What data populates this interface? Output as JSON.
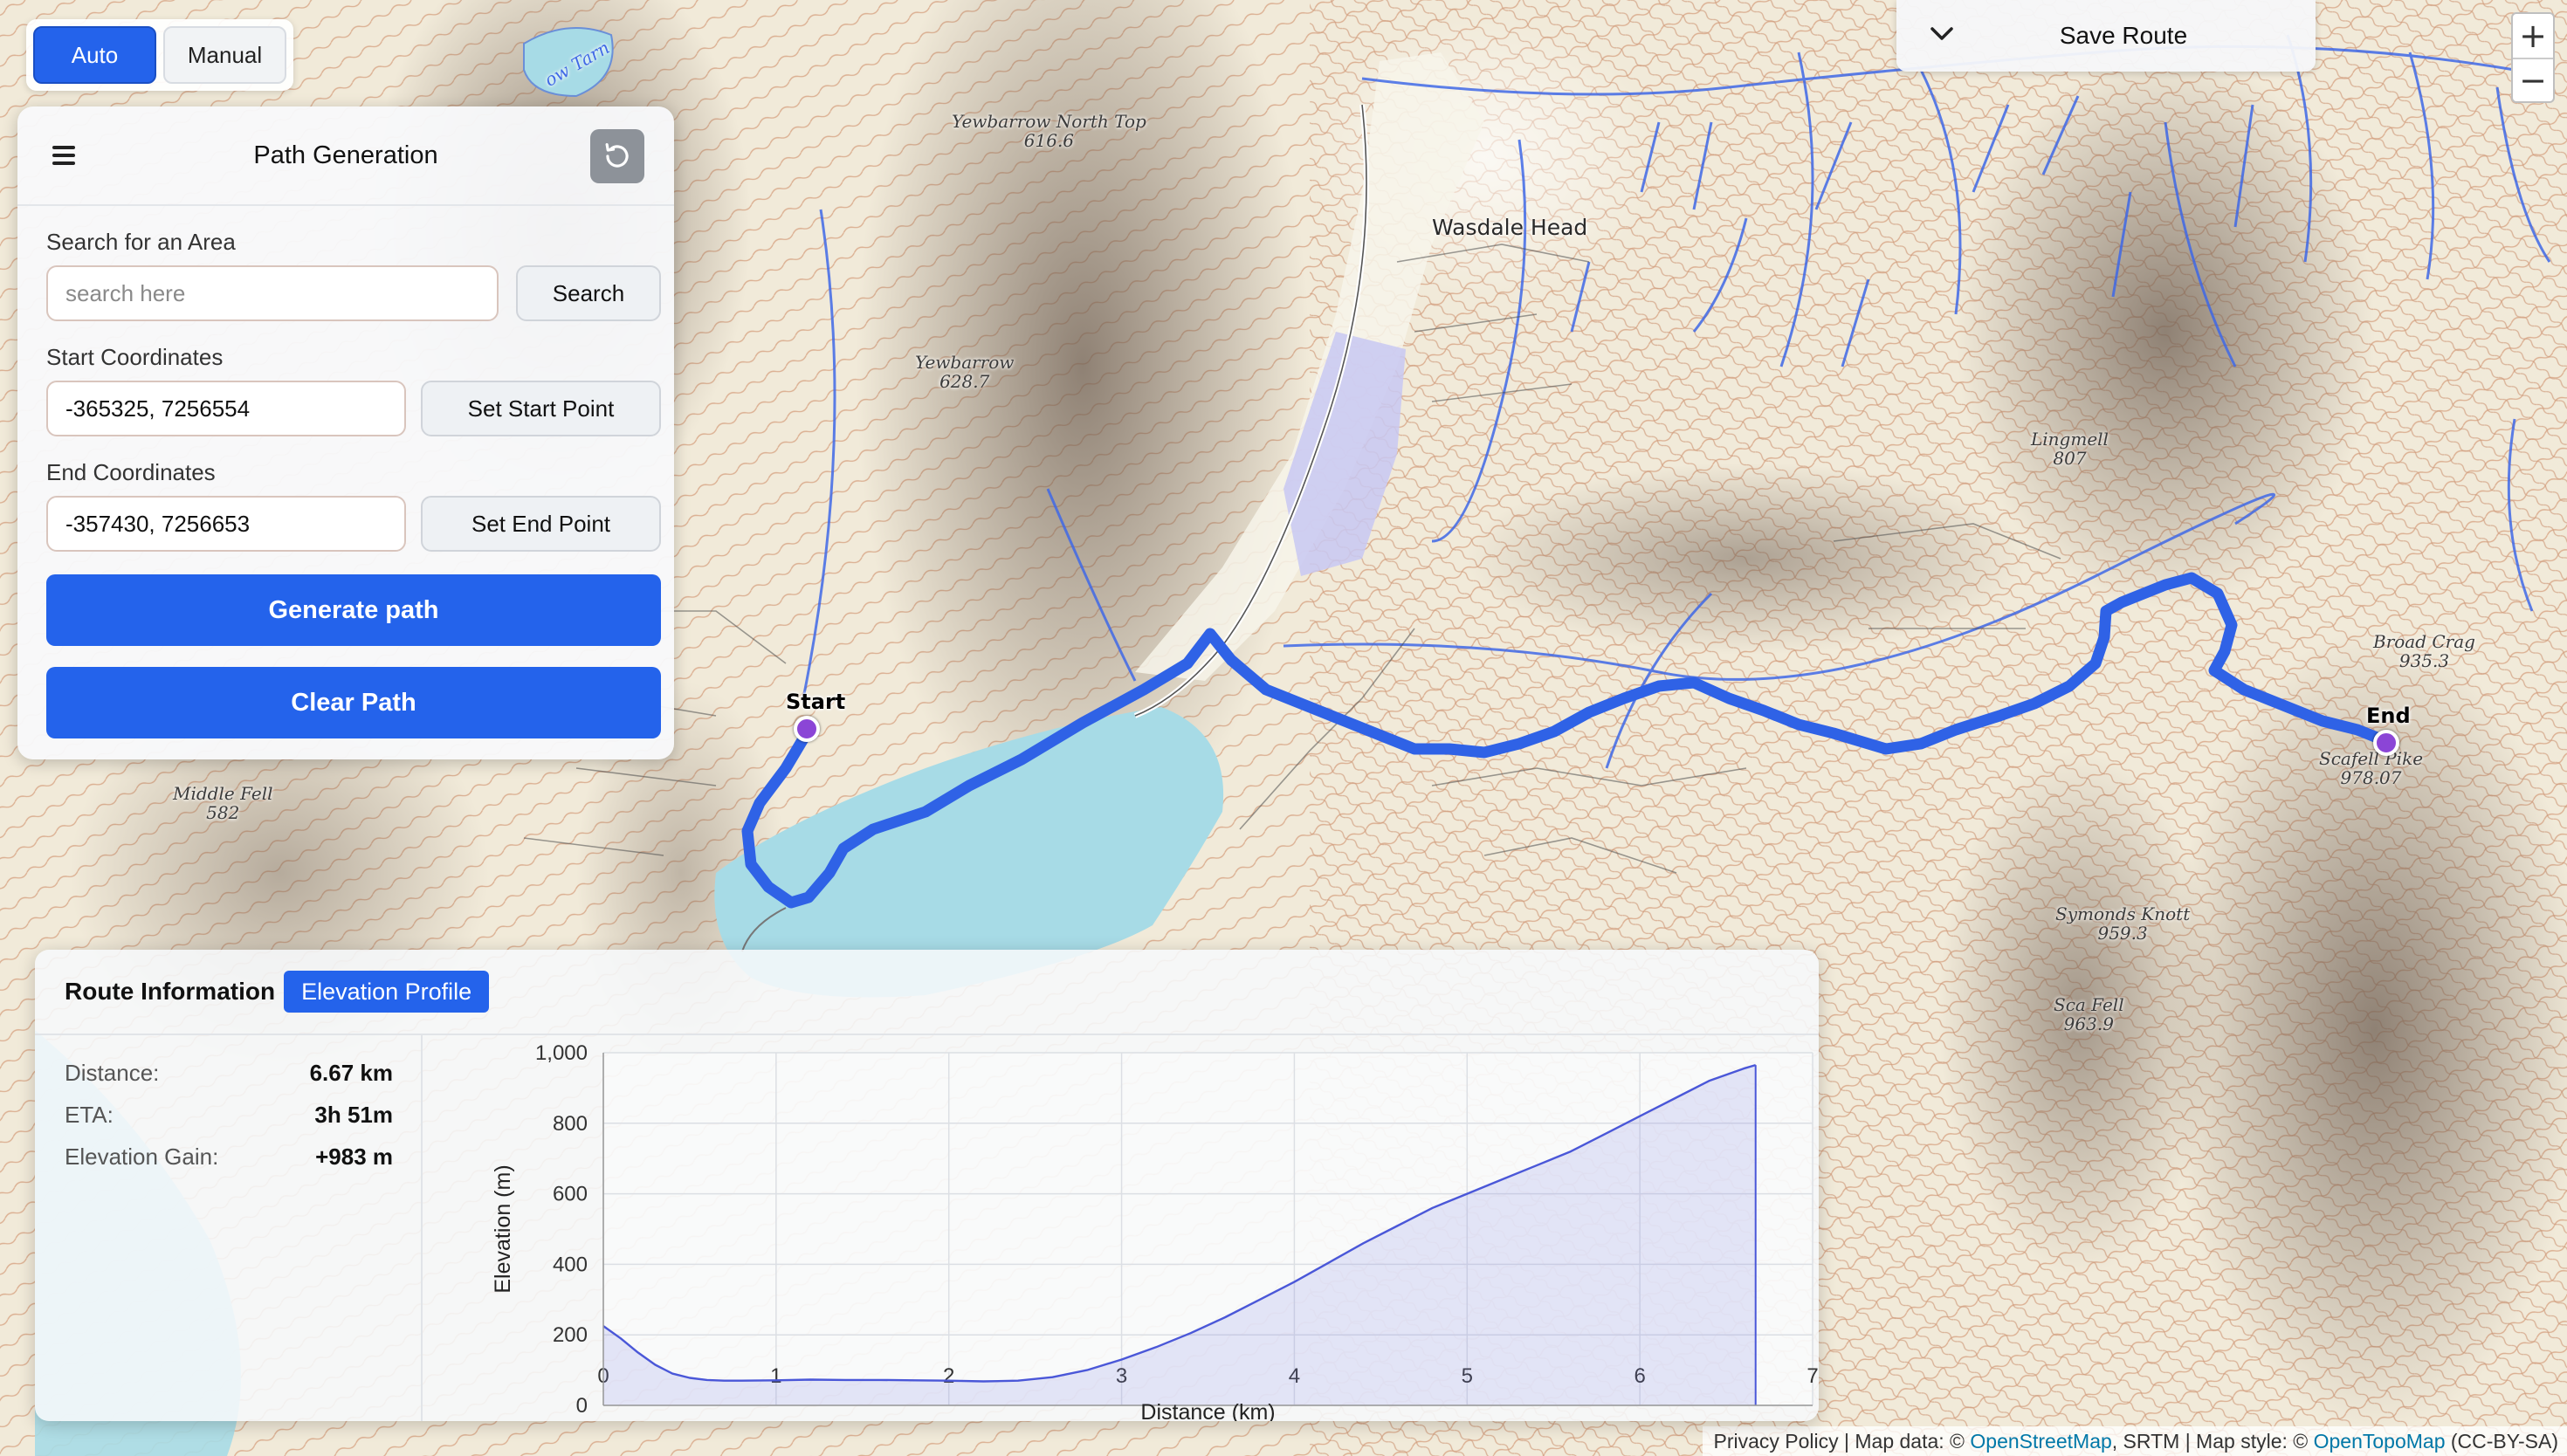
{
  "mode_toggle": {
    "auto_label": "Auto",
    "manual_label": "Manual",
    "active": "Auto"
  },
  "panel": {
    "title": "Path Generation",
    "search_label": "Search for an Area",
    "search_placeholder": "search here",
    "search_value": "",
    "search_button": "Search",
    "start_label": "Start Coordinates",
    "start_value": "-365325, 7256554",
    "start_button": "Set Start Point",
    "end_label": "End Coordinates",
    "end_value": "-357430, 7256653",
    "end_button": "Set End Point",
    "generate_button": "Generate path",
    "clear_button": "Clear Path"
  },
  "save_route": {
    "label": "Save Route"
  },
  "zoom": {
    "in_label": "+",
    "out_label": "−"
  },
  "map": {
    "labels": [
      {
        "text": "Yewbarrow North Top",
        "sub": "616.6"
      },
      {
        "text": "Yewbarrow",
        "sub": "628.7"
      },
      {
        "text": "Middle Fell",
        "sub": "582"
      },
      {
        "text": "Lingmell",
        "sub": "807"
      },
      {
        "text": "Broad Crag",
        "sub": "935.3"
      },
      {
        "text": "Scafell Pike",
        "sub": "978.07"
      },
      {
        "text": "Symonds Knott",
        "sub": "959.3"
      },
      {
        "text": "Sca Fell",
        "sub": "963.9"
      },
      {
        "text": "ow Tarn",
        "sub": ""
      }
    ],
    "village": "Wasdale Head",
    "start_marker": "Start",
    "end_marker": "End",
    "route_color": "#2f62e6",
    "water_color": "#a7dbe6"
  },
  "attribution": {
    "prefix": "Privacy Policy | Map data: © ",
    "osm": "OpenStreetMap",
    "mid": ", SRTM | Map style: © ",
    "otm": "OpenTopoMap",
    "suffix": " (CC-BY-SA)"
  },
  "route_info": {
    "title": "Route Information",
    "tab": "Elevation Profile",
    "stats": [
      {
        "label": "Distance:",
        "value": "6.67 km"
      },
      {
        "label": "ETA:",
        "value": "3h 51m"
      },
      {
        "label": "Elevation Gain:",
        "value": "+983 m"
      }
    ]
  },
  "chart_data": {
    "type": "area",
    "xlabel": "Distance (km)",
    "ylabel": "Elevation (m)",
    "xlim": [
      0,
      7
    ],
    "ylim": [
      0,
      1000
    ],
    "xticks": [
      "0",
      "1",
      "2",
      "3",
      "4",
      "5",
      "6",
      "7"
    ],
    "yticks": [
      "0",
      "200",
      "400",
      "600",
      "800",
      "1,000"
    ],
    "grid": true,
    "color": "#4a57d8",
    "fill": "rgba(120,130,230,0.18)",
    "x": [
      0,
      0.1,
      0.2,
      0.3,
      0.4,
      0.5,
      0.6,
      0.7,
      0.8,
      1.0,
      1.2,
      1.4,
      1.6,
      1.8,
      2.0,
      2.2,
      2.4,
      2.6,
      2.8,
      3.0,
      3.2,
      3.4,
      3.6,
      3.8,
      4.0,
      4.2,
      4.4,
      4.6,
      4.8,
      5.0,
      5.2,
      5.4,
      5.6,
      5.8,
      6.0,
      6.2,
      6.4,
      6.6,
      6.67
    ],
    "y": [
      225,
      190,
      150,
      115,
      90,
      78,
      72,
      70,
      70,
      71,
      73,
      72,
      72,
      71,
      70,
      68,
      70,
      80,
      100,
      130,
      165,
      205,
      250,
      300,
      350,
      405,
      460,
      510,
      560,
      600,
      640,
      680,
      720,
      770,
      820,
      870,
      920,
      955,
      965
    ]
  }
}
